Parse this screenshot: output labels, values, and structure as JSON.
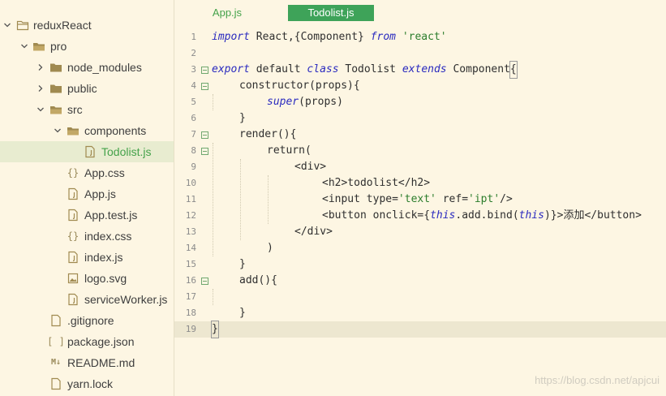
{
  "sidebar": {
    "items": [
      {
        "label": "reduxReact",
        "type": "folder",
        "expanded": true,
        "depth": 0
      },
      {
        "label": "pro",
        "type": "folder",
        "expanded": true,
        "depth": 1
      },
      {
        "label": "node_modules",
        "type": "folder",
        "expanded": false,
        "depth": 2
      },
      {
        "label": "public",
        "type": "folder",
        "expanded": false,
        "depth": 2
      },
      {
        "label": "src",
        "type": "folder",
        "expanded": true,
        "depth": 2
      },
      {
        "label": "components",
        "type": "folder",
        "expanded": true,
        "depth": 3
      },
      {
        "label": "Todolist.js",
        "type": "file-js",
        "depth": 4,
        "selected": true
      },
      {
        "label": "App.css",
        "type": "file-css",
        "depth": 3
      },
      {
        "label": "App.js",
        "type": "file-js",
        "depth": 3
      },
      {
        "label": "App.test.js",
        "type": "file-js",
        "depth": 3
      },
      {
        "label": "index.css",
        "type": "file-css",
        "depth": 3
      },
      {
        "label": "index.js",
        "type": "file-js",
        "depth": 3
      },
      {
        "label": "logo.svg",
        "type": "file-image",
        "depth": 3
      },
      {
        "label": "serviceWorker.js",
        "type": "file-js",
        "depth": 3
      },
      {
        "label": ".gitignore",
        "type": "file-generic",
        "depth": 2
      },
      {
        "label": "package.json",
        "type": "file-json",
        "depth": 2
      },
      {
        "label": "README.md",
        "type": "file-markdown",
        "depth": 2
      },
      {
        "label": "yarn.lock",
        "type": "file-generic",
        "depth": 2
      }
    ],
    "glyphs": {
      "css": "{}",
      "json": "[ ]",
      "markdown": "M↓"
    }
  },
  "tabs": [
    {
      "label": "App.js",
      "active": false
    },
    {
      "label": "Todolist.js",
      "active": true
    }
  ],
  "editor": {
    "current_line": 19,
    "lines": [
      {
        "n": "1"
      },
      {
        "n": "2"
      },
      {
        "n": "3"
      },
      {
        "n": "4"
      },
      {
        "n": "5"
      },
      {
        "n": "6"
      },
      {
        "n": "7"
      },
      {
        "n": "8"
      },
      {
        "n": "9"
      },
      {
        "n": "10"
      },
      {
        "n": "11"
      },
      {
        "n": "12"
      },
      {
        "n": "13"
      },
      {
        "n": "14"
      },
      {
        "n": "15"
      },
      {
        "n": "16"
      },
      {
        "n": "17"
      },
      {
        "n": "18"
      },
      {
        "n": "19"
      }
    ],
    "tokens": {
      "l1": [
        "import",
        " React,{Component} ",
        "from",
        " ",
        "'react'"
      ],
      "l3": [
        "export",
        " default ",
        "class",
        " Todolist ",
        "extends",
        " Component",
        "{"
      ],
      "l4": [
        "constructor(props){"
      ],
      "l5": [
        "super",
        "(props)"
      ],
      "l6": [
        "}"
      ],
      "l7": [
        "render(){"
      ],
      "l8": [
        "return("
      ],
      "l9": [
        "<div>"
      ],
      "l10": [
        "<h2>todolist</h2>"
      ],
      "l11": [
        "<input type=",
        "'text'",
        " ref=",
        "'ipt'",
        "/>"
      ],
      "l12": [
        "<button onclick={",
        "this",
        ".add.bind(",
        "this",
        ")}>",
        "添加",
        "</button>"
      ],
      "l13": [
        "</div>"
      ],
      "l14": [
        ")"
      ],
      "l15": [
        "}"
      ],
      "l16": [
        "add(){"
      ],
      "l18": [
        "}"
      ],
      "l19": [
        "}"
      ]
    }
  },
  "watermark": "https://blog.csdn.net/apjcui",
  "colors": {
    "background": "#fdf6e3",
    "selection": "#e8ecd0",
    "active_tab": "#3ea359",
    "keyword": "#2a2abf",
    "string": "#2c7d2c"
  }
}
